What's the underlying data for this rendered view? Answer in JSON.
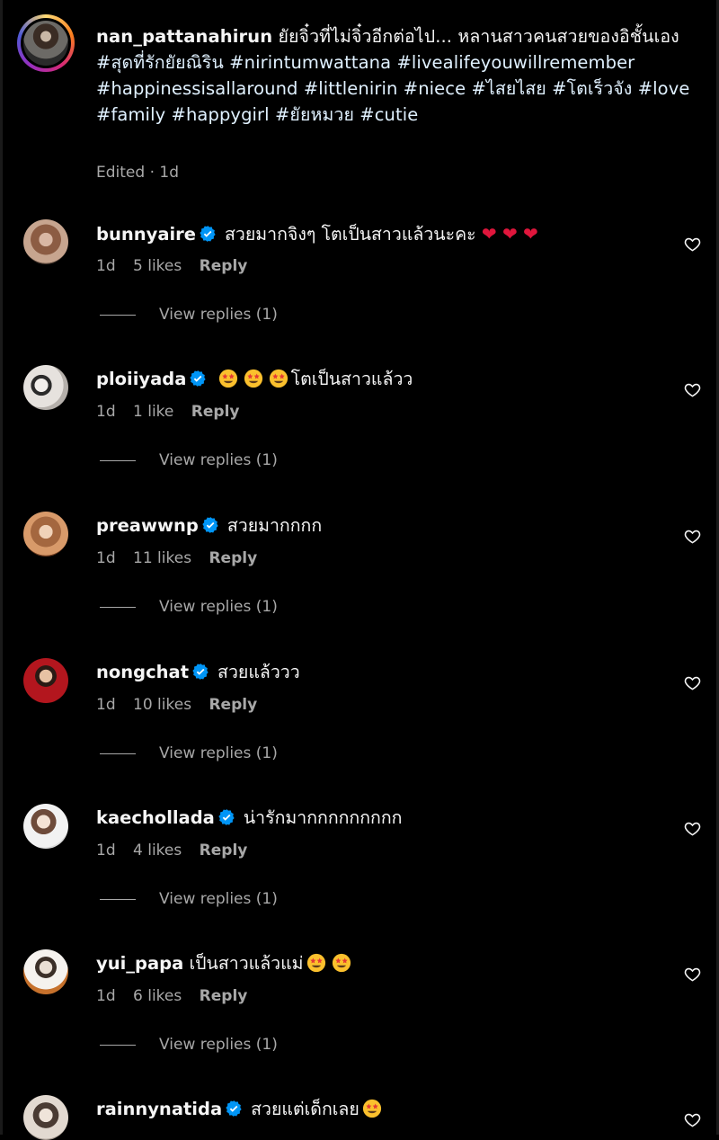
{
  "caption": {
    "username": "nan_pattanahirun",
    "text": "ยัยจิ๋วที่ไม่จิ๋วอีกต่อไป... หลานสาวคนสวยของอิชั้นเอง",
    "hashtags": "#สุดที่รักยัยณิริน #nirintumwattana #livealifeyouwillremember #happinessisallaround #littlenirin #niece #ไสยไสย #โตเร็วจัง #love #family #happygirl #ยัยหมวย #cutie",
    "meta": "Edited · 1d"
  },
  "colors": {
    "background": "#000000",
    "primary_text": "#f5f5f5",
    "secondary_text": "#a8a8a8",
    "verified": "#0095f6",
    "heart_emoji": "#e0163c"
  },
  "comments": [
    {
      "username": "bunnyaire",
      "verified": true,
      "text": "สวยมากจิงๆ โตเป็นสาวแล้วนะคะ",
      "emoji_suffix": "❤ ❤ ❤",
      "time": "1d",
      "likes": "5 likes",
      "reply": "Reply",
      "view_replies": "View replies (1)"
    },
    {
      "username": "ploiiyada",
      "verified": true,
      "text": "โตเป็นสาวแล้วว",
      "emoji_prefix": "3x star-struck",
      "time": "1d",
      "likes": "1 like",
      "reply": "Reply",
      "view_replies": "View replies (1)"
    },
    {
      "username": "preawwnp",
      "verified": true,
      "text": "สวยมากกกก",
      "time": "1d",
      "likes": "11 likes",
      "reply": "Reply",
      "view_replies": "View replies (1)"
    },
    {
      "username": "nongchat",
      "verified": true,
      "text": "สวยแล้ววว",
      "time": "1d",
      "likes": "10 likes",
      "reply": "Reply",
      "view_replies": "View replies (1)"
    },
    {
      "username": "kaechollada",
      "verified": true,
      "text": "น่ารักมากกกกกกกกก",
      "time": "1d",
      "likes": "4 likes",
      "reply": "Reply",
      "view_replies": "View replies (1)"
    },
    {
      "username": "yui_papa",
      "verified": false,
      "text": "เป็นสาวแล้วแม่",
      "emoji_suffix": "2x star-struck",
      "time": "1d",
      "likes": "6 likes",
      "reply": "Reply",
      "view_replies": "View replies (1)"
    },
    {
      "username": "rainnynatida",
      "verified": true,
      "text": "สวยแต่เด็กเลย",
      "emoji_suffix": "1x star-struck"
    }
  ]
}
